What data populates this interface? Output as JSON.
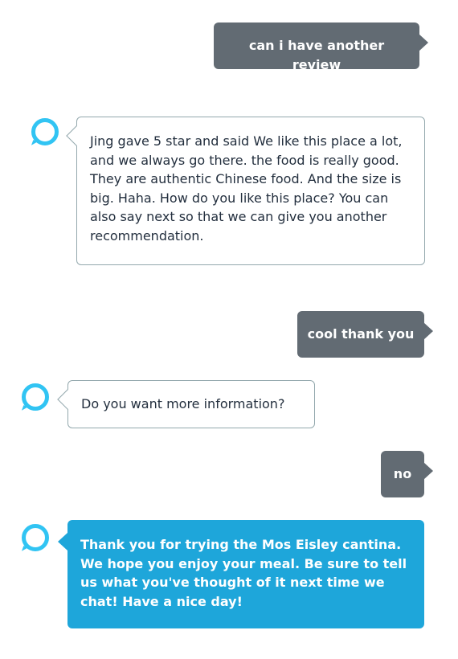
{
  "conversation": {
    "messages": [
      {
        "sender": "user",
        "text": "can i have another review"
      },
      {
        "sender": "assistant",
        "text": "Jing gave 5 star and said We like this place a lot, and we always go there. the food is really good. They are authentic Chinese food. And the size is big. Haha. How do you like this place? You can also say next so that we can give you another recommendation."
      },
      {
        "sender": "user",
        "text": "cool thank you"
      },
      {
        "sender": "assistant",
        "text": "Do you want more information?"
      },
      {
        "sender": "user",
        "text": "no"
      },
      {
        "sender": "assistant",
        "text": "Thank you for trying the Mos Eisley cantina. We hope you enjoy your meal. Be sure to tell us what you've thought of it next time we chat! Have a nice day!"
      }
    ]
  },
  "assistant_avatar": {
    "icon": "alexa-ring-icon",
    "color": "#31c4f3"
  },
  "colors": {
    "user_bubble": "#626b73",
    "assistant_bubble_border": "#93a8ad",
    "assistant_text": "#232f3e",
    "highlight_bubble": "#1ea6da"
  }
}
